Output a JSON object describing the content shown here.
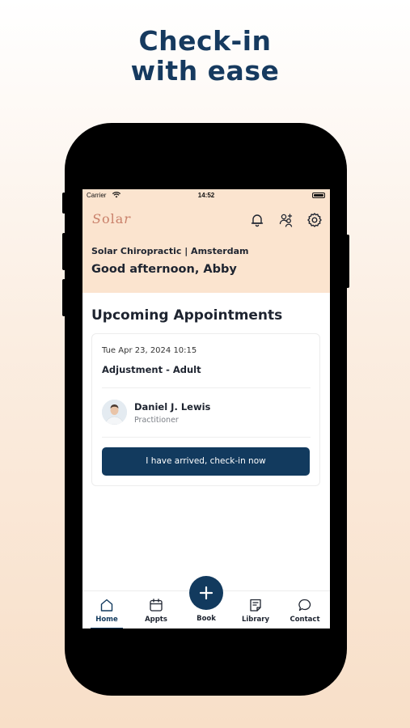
{
  "headline": {
    "line1": "Check-in",
    "line2": "with ease"
  },
  "status_bar": {
    "carrier": "Carrier",
    "time": "14:52"
  },
  "header": {
    "logo_text": "Solar",
    "clinic": "Solar Chiropractic | Amsterdam",
    "greeting": "Good afternoon, Abby",
    "icons": [
      "bell-icon",
      "users-icon",
      "gear-icon"
    ]
  },
  "main": {
    "section_title": "Upcoming Appointments",
    "appointment": {
      "datetime": "Tue Apr 23, 2024 10:15",
      "type": "Adjustment - Adult",
      "practitioner_name": "Daniel J. Lewis",
      "practitioner_role": "Practitioner",
      "checkin_label": "I have arrived, check-in now"
    }
  },
  "tabbar": {
    "tabs": [
      {
        "label": "Home",
        "icon": "home-icon",
        "active": true
      },
      {
        "label": "Appts",
        "icon": "calendar-icon"
      },
      {
        "label": "Book",
        "icon": "plus-icon"
      },
      {
        "label": "Library",
        "icon": "library-icon"
      },
      {
        "label": "Contact",
        "icon": "chat-icon"
      }
    ]
  },
  "colors": {
    "brand": "#123a5e",
    "header_bg": "#fbe4cf",
    "logo": "#c9806a"
  }
}
